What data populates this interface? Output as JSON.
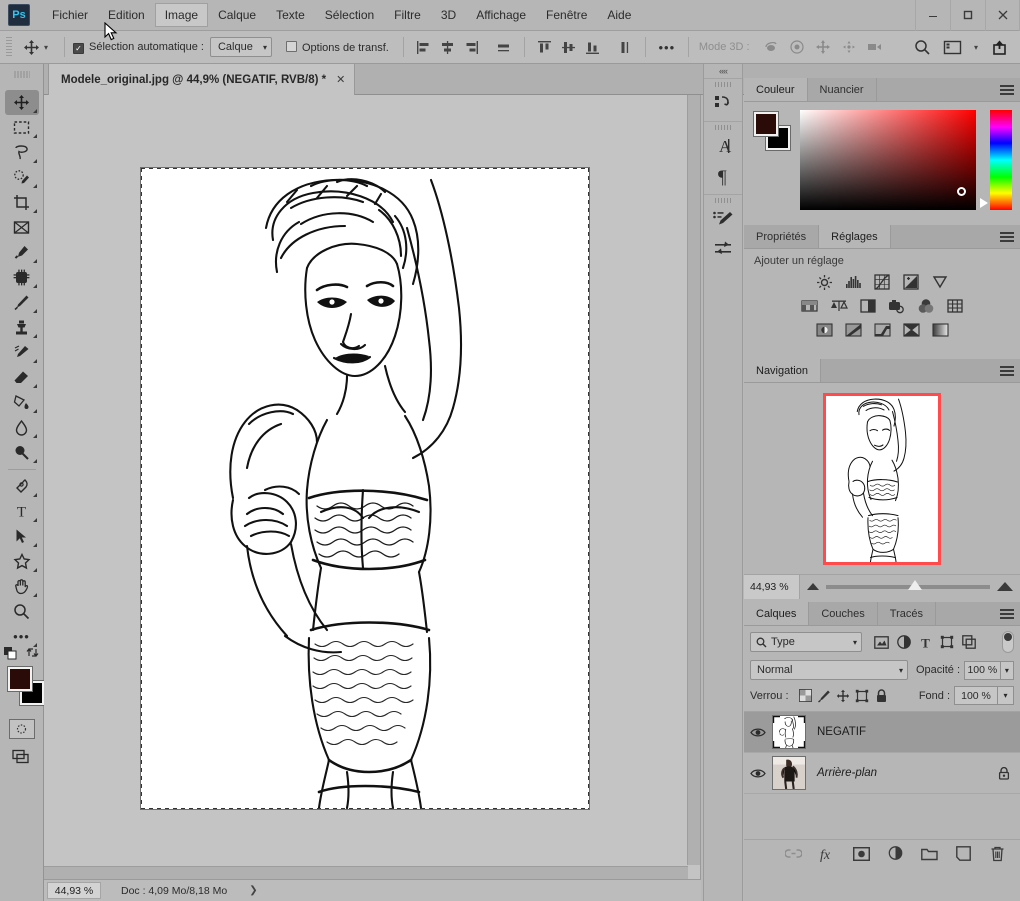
{
  "app": {
    "logo": "Ps"
  },
  "menubar": {
    "items": [
      {
        "label": "Fichier",
        "active": false
      },
      {
        "label": "Edition",
        "active": false
      },
      {
        "label": "Image",
        "active": true
      },
      {
        "label": "Calque",
        "active": false
      },
      {
        "label": "Texte",
        "active": false
      },
      {
        "label": "Sélection",
        "active": false
      },
      {
        "label": "Filtre",
        "active": false
      },
      {
        "label": "3D",
        "active": false
      },
      {
        "label": "Affichage",
        "active": false
      },
      {
        "label": "Fenêtre",
        "active": false
      },
      {
        "label": "Aide",
        "active": false
      }
    ],
    "window_buttons": [
      {
        "name": "minimize",
        "glyph": "—"
      },
      {
        "name": "maximize",
        "glyph": "▢"
      },
      {
        "name": "close",
        "glyph": "✕"
      }
    ]
  },
  "options_bar": {
    "tool_icon": "move-tool-icon",
    "auto_select_label": "Sélection automatique :",
    "auto_select_checked": true,
    "auto_select_target": "Calque",
    "transform_options_label": "Options de transf.",
    "transform_options_checked": false,
    "align_icons": [
      "align-left-edges-icon",
      "align-horizontal-centers-icon",
      "align-right-edges-icon",
      "distribute-horizontal-icon"
    ],
    "align_icons2": [
      "align-top-edges-icon",
      "align-vertical-centers-icon",
      "align-bottom-edges-icon",
      "distribute-vertical-icon"
    ],
    "more_label": "•••",
    "mode_3d_label": "Mode 3D :",
    "mode_3d_icons": [
      "orbit-3d-icon",
      "roll-3d-icon",
      "pan-3d-icon",
      "slide-3d-icon",
      "camera-3d-icon"
    ],
    "right_icons": [
      "search-icon",
      "workspace-icon",
      "chevron-down-icon",
      "share-icon"
    ]
  },
  "tabbar": {
    "collapse_left": "»",
    "collapse_right": "»",
    "document_title": "Modele_original.jpg @ 44,9% (NEGATIF, RVB/8) *",
    "close_glyph": "✕"
  },
  "toolbar": {
    "tools": [
      {
        "name": "move-tool",
        "selected": true,
        "submenu": true
      },
      {
        "name": "rectangular-marquee-tool",
        "selected": false,
        "submenu": true
      },
      {
        "name": "lasso-tool",
        "selected": false,
        "submenu": true
      },
      {
        "name": "quick-selection-tool",
        "selected": false,
        "submenu": true
      },
      {
        "name": "crop-tool",
        "selected": false,
        "submenu": true
      },
      {
        "name": "frame-tool",
        "selected": false,
        "submenu": false
      },
      {
        "name": "eyedropper-tool",
        "selected": false,
        "submenu": true
      },
      {
        "name": "spot-healing-brush-tool",
        "selected": false,
        "submenu": true
      },
      {
        "name": "brush-tool",
        "selected": false,
        "submenu": true
      },
      {
        "name": "clone-stamp-tool",
        "selected": false,
        "submenu": true
      },
      {
        "name": "history-brush-tool",
        "selected": false,
        "submenu": true
      },
      {
        "name": "eraser-tool",
        "selected": false,
        "submenu": true
      },
      {
        "name": "gradient-tool",
        "selected": false,
        "submenu": true
      },
      {
        "name": "blur-tool",
        "selected": false,
        "submenu": true
      },
      {
        "name": "dodge-tool",
        "selected": false,
        "submenu": true
      },
      {
        "name": "pen-tool",
        "selected": false,
        "submenu": true
      },
      {
        "name": "type-tool",
        "selected": false,
        "submenu": true
      },
      {
        "name": "path-selection-tool",
        "selected": false,
        "submenu": true
      },
      {
        "name": "custom-shape-tool",
        "selected": false,
        "submenu": true
      },
      {
        "name": "hand-tool",
        "selected": false,
        "submenu": true
      },
      {
        "name": "zoom-tool",
        "selected": false,
        "submenu": false
      },
      {
        "name": "edit-toolbar",
        "selected": false,
        "submenu": true
      }
    ],
    "foreground_color": "#2b0b08",
    "background_color": "#000000",
    "quick_mask_name": "quick-mask-mode",
    "screen_mode_name": "screen-mode"
  },
  "canvas": {
    "image_name": "Modele_original.jpg",
    "background": "#c4c4c4"
  },
  "statusbar": {
    "zoom": "44,93 %",
    "doc_info": "Doc : 4,09 Mo/8,18 Mo",
    "arrow": "❯"
  },
  "rail": {
    "collapse": "««",
    "groups": [
      {
        "icons": [
          {
            "name": "history-icon",
            "glyph": "⎋"
          }
        ]
      },
      {
        "icons": [
          {
            "name": "character-panel-icon",
            "glyph": "A"
          },
          {
            "name": "paragraph-panel-icon",
            "glyph": "¶"
          }
        ]
      },
      {
        "icons": [
          {
            "name": "brush-settings-icon",
            "glyph": "✎"
          },
          {
            "name": "brush-presets-icon",
            "glyph": "≔"
          }
        ]
      }
    ]
  },
  "color_panel": {
    "tabs": [
      {
        "label": "Couleur",
        "active": true
      },
      {
        "label": "Nuancier",
        "active": false
      }
    ],
    "foreground_color": "#2b0b08",
    "background_color": "#000000",
    "menu_name": "panel-menu-icon"
  },
  "adjust_panel": {
    "tabs": [
      {
        "label": "Propriétés",
        "active": false
      },
      {
        "label": "Réglages",
        "active": true
      }
    ],
    "title": "Ajouter un réglage",
    "row1": [
      {
        "name": "brightness-contrast-icon",
        "glyph": "☀"
      },
      {
        "name": "levels-icon",
        "glyph": "▥"
      },
      {
        "name": "curves-icon",
        "glyph": "▦"
      },
      {
        "name": "exposure-icon",
        "glyph": "±"
      },
      {
        "name": "vibrance-icon",
        "glyph": "▽"
      }
    ],
    "row2": [
      {
        "name": "hue-saturation-icon",
        "glyph": "▤"
      },
      {
        "name": "color-balance-icon",
        "glyph": "⚖"
      },
      {
        "name": "black-white-icon",
        "glyph": "◧"
      },
      {
        "name": "photo-filter-icon",
        "glyph": "◕"
      },
      {
        "name": "channel-mixer-icon",
        "glyph": "◎"
      },
      {
        "name": "color-lookup-icon",
        "glyph": "⊞"
      }
    ],
    "row3": [
      {
        "name": "invert-icon",
        "glyph": "◨"
      },
      {
        "name": "posterize-icon",
        "glyph": "▨"
      },
      {
        "name": "threshold-icon",
        "glyph": "▩"
      },
      {
        "name": "selective-color-icon",
        "glyph": "▼"
      },
      {
        "name": "gradient-map-icon",
        "glyph": "▭"
      }
    ]
  },
  "nav_panel": {
    "tabs": [
      {
        "label": "Navigation",
        "active": true
      }
    ],
    "zoom_value": "44,93 %",
    "view_box_color": "#ff4b4b",
    "menu_name": "panel-menu-icon"
  },
  "layers_panel": {
    "tabs": [
      {
        "label": "Calques",
        "active": true
      },
      {
        "label": "Couches",
        "active": false
      },
      {
        "label": "Tracés",
        "active": false
      }
    ],
    "filter_label": "Type",
    "filter_icons": [
      {
        "name": "filter-pixel-icon",
        "glyph": "▣"
      },
      {
        "name": "filter-adjustment-icon",
        "glyph": "◑"
      },
      {
        "name": "filter-type-icon",
        "glyph": "T"
      },
      {
        "name": "filter-shape-icon",
        "glyph": "⬚"
      },
      {
        "name": "filter-smart-object-icon",
        "glyph": "⧉"
      }
    ],
    "blend_mode": "Normal",
    "opacity_label": "Opacité :",
    "opacity_value": "100 %",
    "lock_label": "Verrou :",
    "lock_icons": [
      {
        "name": "lock-transparent-pixels-icon",
        "glyph": "▨"
      },
      {
        "name": "lock-image-pixels-icon",
        "glyph": "✎"
      },
      {
        "name": "lock-position-icon",
        "glyph": "✛"
      },
      {
        "name": "lock-artboard-nesting-icon",
        "glyph": "⬚"
      },
      {
        "name": "lock-all-icon",
        "glyph": "🔒"
      }
    ],
    "fill_label": "Fond :",
    "fill_value": "100 %",
    "layers": [
      {
        "name": "NEGATIF",
        "selected": true,
        "visible": true,
        "locked": false,
        "italic": false
      },
      {
        "name": "Arrière-plan",
        "selected": false,
        "visible": true,
        "locked": true,
        "italic": true
      }
    ],
    "footer_icons": [
      {
        "name": "link-layers-icon",
        "glyph": "⛓",
        "dim": true
      },
      {
        "name": "layer-style-icon",
        "glyph": "fx",
        "dim": false
      },
      {
        "name": "layer-mask-icon",
        "glyph": "◙",
        "dim": false
      },
      {
        "name": "new-fill-adjustment-icon",
        "glyph": "◑",
        "dim": false
      },
      {
        "name": "new-group-icon",
        "glyph": "▭",
        "dim": false
      },
      {
        "name": "new-layer-icon",
        "glyph": "⊞",
        "dim": false
      },
      {
        "name": "delete-layer-icon",
        "glyph": "🗑",
        "dim": false
      }
    ]
  }
}
